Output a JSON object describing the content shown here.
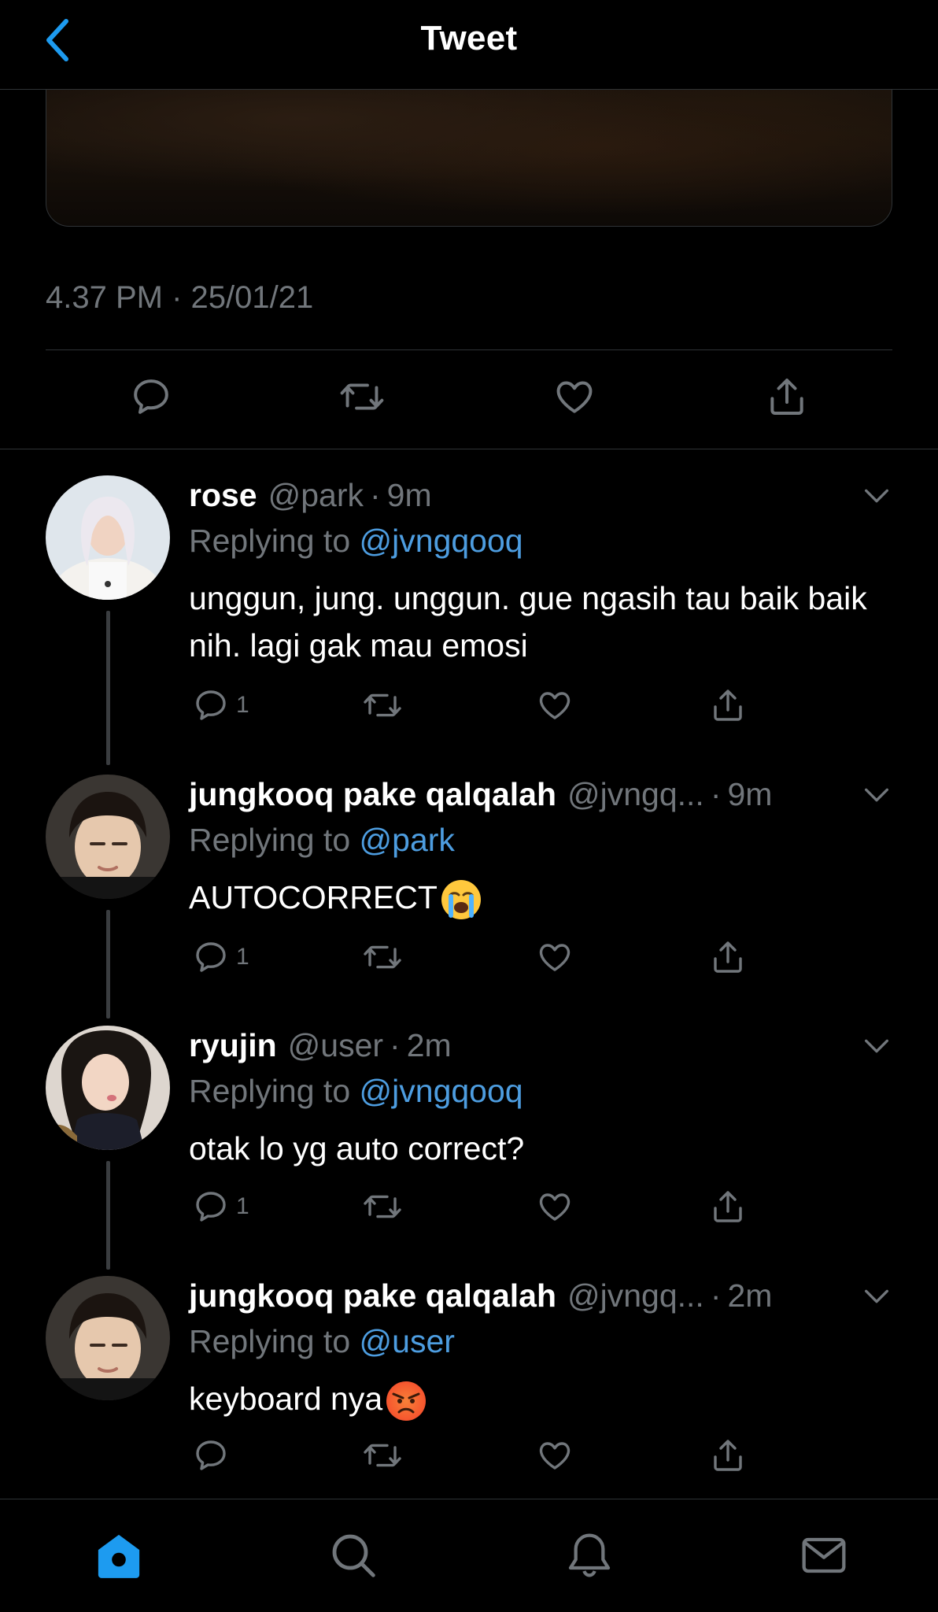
{
  "header": {
    "title": "Tweet"
  },
  "tweet": {
    "timestamp": "4.37 PM · 25/01/21"
  },
  "replies": [
    {
      "display_name": "rose",
      "handle": "@park",
      "time": "9m",
      "replying_label": "Replying to",
      "replying_to": "@jvngqooq",
      "text": "unggun, jung. unggun. gue ngasih tau baik baik nih. lagi gak mau emosi",
      "reply_count": "1"
    },
    {
      "display_name": "jungkooq pake qalqalah",
      "handle": "@jvngq...",
      "time": "9m",
      "replying_label": "Replying to",
      "replying_to": "@park",
      "text": "AUTOCORRECT",
      "emoji": "crying-face",
      "reply_count": "1"
    },
    {
      "display_name": "ryujin",
      "handle": "@user",
      "time": "2m",
      "replying_label": "Replying to",
      "replying_to": "@jvngqooq",
      "text": "otak lo yg auto correct?",
      "reply_count": "1"
    },
    {
      "display_name": "jungkooq pake qalqalah",
      "handle": "@jvngq...",
      "time": "2m",
      "replying_label": "Replying to",
      "replying_to": "@user",
      "text": "keyboard nya",
      "emoji": "angry-face",
      "reply_count": ""
    }
  ],
  "icons": {
    "back": "chevron-left-icon",
    "reply": "speech-bubble-icon",
    "retweet": "retweet-icon",
    "like": "heart-icon",
    "share": "share-icon",
    "more": "chevron-down-icon",
    "home": "home-icon",
    "search": "search-icon",
    "notifications": "bell-icon",
    "messages": "mail-icon"
  },
  "colors": {
    "accent": "#1d9bf0",
    "mention": "#4d9de0",
    "muted": "#71767b",
    "background": "#000000"
  },
  "tabbar": {
    "active": "home"
  }
}
